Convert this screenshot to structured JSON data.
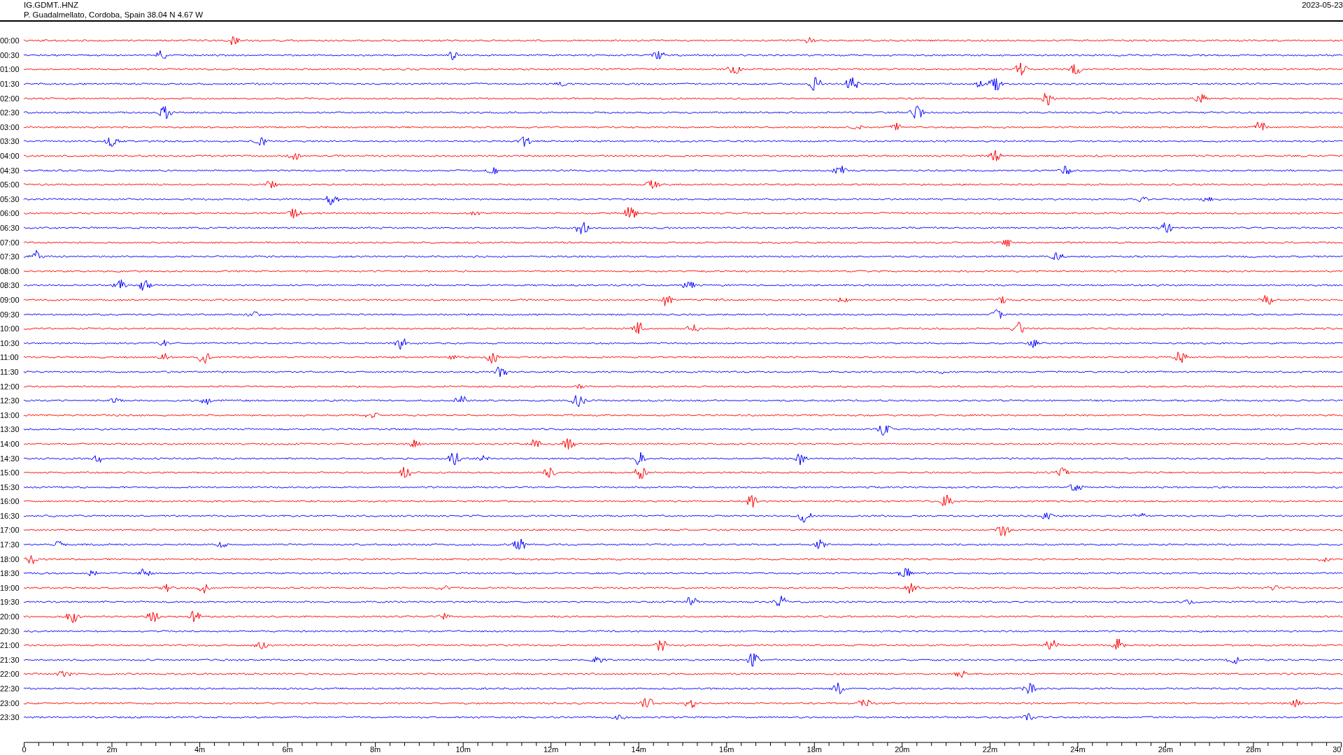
{
  "header": {
    "station": "IG.GDMT..HNZ",
    "location": "P. Guadalmellato, Cordoba, Spain  38.04 N 4.67 W",
    "date": "2023-05-23"
  },
  "traces": [
    {
      "label": "00:00",
      "color": "#ff0000"
    },
    {
      "label": "00:30",
      "color": "#0000ff"
    },
    {
      "label": "01:00",
      "color": "#ff0000"
    },
    {
      "label": "01:30",
      "color": "#0000ff"
    },
    {
      "label": "02:00",
      "color": "#ff0000"
    },
    {
      "label": "02:30",
      "color": "#0000ff"
    },
    {
      "label": "03:00",
      "color": "#ff0000"
    },
    {
      "label": "03:30",
      "color": "#0000ff"
    },
    {
      "label": "04:00",
      "color": "#ff0000"
    },
    {
      "label": "04:30",
      "color": "#0000ff"
    },
    {
      "label": "05:00",
      "color": "#ff0000"
    },
    {
      "label": "05:30",
      "color": "#0000ff"
    },
    {
      "label": "06:00",
      "color": "#ff0000"
    },
    {
      "label": "06:30",
      "color": "#0000ff"
    },
    {
      "label": "07:00",
      "color": "#ff0000"
    },
    {
      "label": "07:30",
      "color": "#0000ff"
    },
    {
      "label": "08:00",
      "color": "#ff0000"
    },
    {
      "label": "08:30",
      "color": "#0000ff"
    },
    {
      "label": "09:00",
      "color": "#ff0000"
    },
    {
      "label": "09:30",
      "color": "#0000ff"
    },
    {
      "label": "10:00",
      "color": "#ff0000"
    },
    {
      "label": "10:30",
      "color": "#0000ff"
    },
    {
      "label": "11:00",
      "color": "#ff0000"
    },
    {
      "label": "11:30",
      "color": "#0000ff"
    },
    {
      "label": "12:00",
      "color": "#ff0000"
    },
    {
      "label": "12:30",
      "color": "#0000ff"
    },
    {
      "label": "13:00",
      "color": "#ff0000"
    },
    {
      "label": "13:30",
      "color": "#0000ff"
    },
    {
      "label": "14:00",
      "color": "#ff0000"
    },
    {
      "label": "14:30",
      "color": "#0000ff"
    },
    {
      "label": "15:00",
      "color": "#ff0000"
    },
    {
      "label": "15:30",
      "color": "#0000ff"
    },
    {
      "label": "16:00",
      "color": "#ff0000"
    },
    {
      "label": "16:30",
      "color": "#0000ff"
    },
    {
      "label": "17:00",
      "color": "#ff0000"
    },
    {
      "label": "17:30",
      "color": "#0000ff"
    },
    {
      "label": "18:00",
      "color": "#ff0000"
    },
    {
      "label": "18:30",
      "color": "#0000ff"
    },
    {
      "label": "19:00",
      "color": "#ff0000"
    },
    {
      "label": "19:30",
      "color": "#0000ff"
    },
    {
      "label": "20:00",
      "color": "#ff0000"
    },
    {
      "label": "20:30",
      "color": "#0000ff"
    },
    {
      "label": "21:00",
      "color": "#ff0000"
    },
    {
      "label": "21:30",
      "color": "#0000ff"
    },
    {
      "label": "22:00",
      "color": "#ff0000"
    },
    {
      "label": "22:30",
      "color": "#0000ff"
    },
    {
      "label": "23:00",
      "color": "#ff0000"
    },
    {
      "label": "23:30",
      "color": "#0000ff"
    }
  ],
  "x_axis": {
    "labels": [
      "0",
      "2m",
      "4m",
      "6m",
      "8m",
      "10m",
      "12m",
      "14m",
      "16m",
      "18m",
      "20m",
      "22m",
      "24m",
      "26m",
      "28m",
      "30"
    ]
  }
}
